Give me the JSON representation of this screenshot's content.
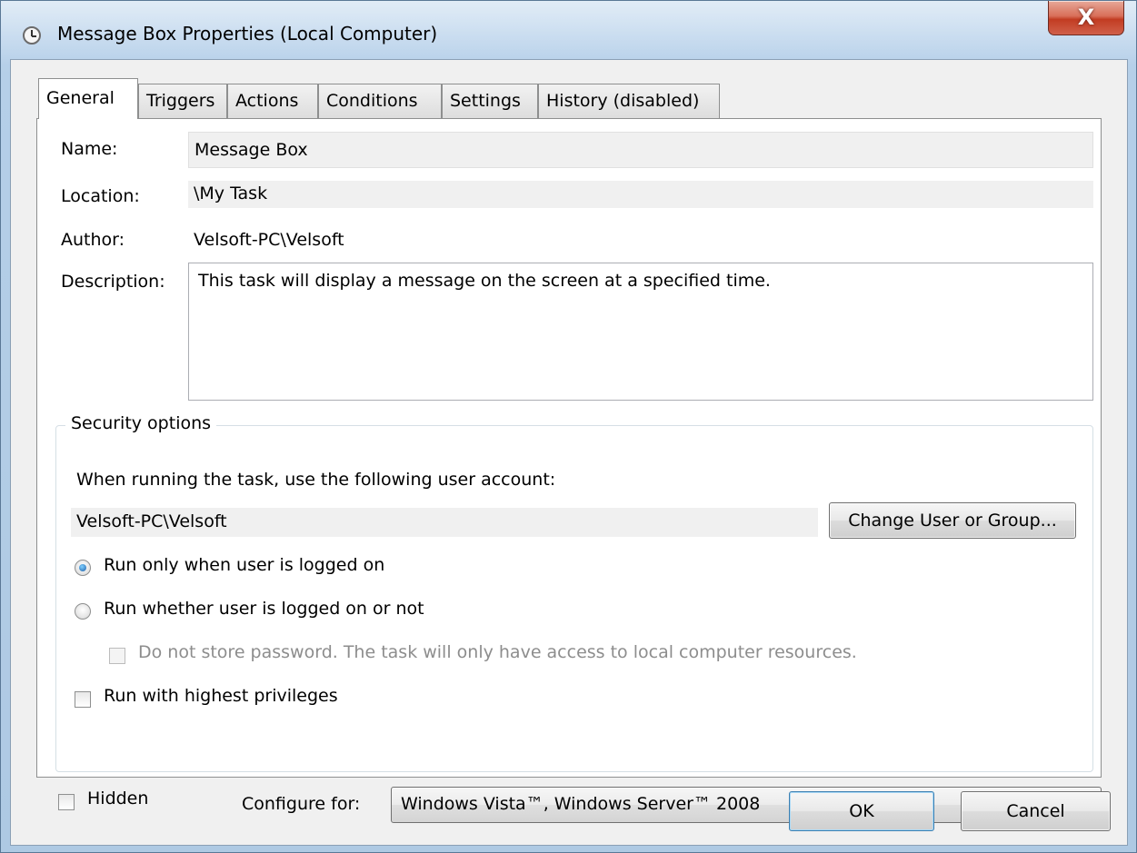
{
  "window": {
    "title": "Message Box Properties (Local Computer)",
    "close_label": "X"
  },
  "tabs": [
    {
      "label": "General",
      "active": true
    },
    {
      "label": "Triggers"
    },
    {
      "label": "Actions"
    },
    {
      "label": "Conditions"
    },
    {
      "label": "Settings"
    },
    {
      "label": "History (disabled)"
    }
  ],
  "general": {
    "name_label": "Name:",
    "name_value": "Message Box",
    "location_label": "Location:",
    "location_value": "\\My Task",
    "author_label": "Author:",
    "author_value": "Velsoft-PC\\Velsoft",
    "description_label": "Description:",
    "description_value": "This task will display a message on the screen at a specified time."
  },
  "security": {
    "title": "Security options",
    "account_prompt": "When running the task, use the following user account:",
    "account_value": "Velsoft-PC\\Velsoft",
    "change_button": "Change User or Group...",
    "radio_logged_on": "Run only when user is logged on",
    "radio_logged_on_checked": true,
    "radio_whether": "Run whether user is logged on or not",
    "no_store_password": "Do not store password.  The task will only have access to local computer resources.",
    "highest_privileges": "Run with highest privileges"
  },
  "bottom": {
    "hidden_label": "Hidden",
    "configure_label": "Configure for:",
    "configure_value": "Windows Vista™, Windows Server™ 2008"
  },
  "buttons": {
    "ok": "OK",
    "cancel": "Cancel"
  }
}
